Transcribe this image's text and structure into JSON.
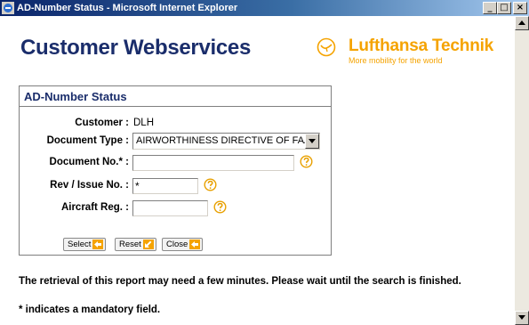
{
  "window": {
    "title": "AD-Number Status - Microsoft Internet Explorer",
    "minimize": "_",
    "maximize": "□",
    "close": "×"
  },
  "header": {
    "title": "Customer Webservices",
    "brand_name": "Lufthansa Technik",
    "brand_tagline": "More mobility for the world",
    "brand_color": "#f5a300",
    "title_color": "#1a2d6b"
  },
  "form": {
    "heading": "AD-Number Status",
    "customer_label": "Customer :",
    "customer_value": "DLH",
    "doc_type_label": "Document Type :",
    "doc_type_value": "AIRWORTHINESS DIRECTIVE OF FAA",
    "doc_no_label": "Document No.* :",
    "doc_no_value": "",
    "rev_label": "Rev / Issue No. :",
    "rev_value": "*",
    "aircraft_label": "Aircraft Reg. :",
    "aircraft_value": "",
    "buttons": {
      "select": "Select",
      "reset": "Reset",
      "close": "Close"
    }
  },
  "messages": {
    "retrieval": "The retrieval of this report may need a few minutes. Please wait until the search is finished.",
    "mandatory": "* indicates a mandatory field."
  },
  "icons": {
    "help": "question-circle-icon",
    "button_arrow": "arrow-left-icon",
    "reset_arrow": "arrow-down-left-icon"
  }
}
